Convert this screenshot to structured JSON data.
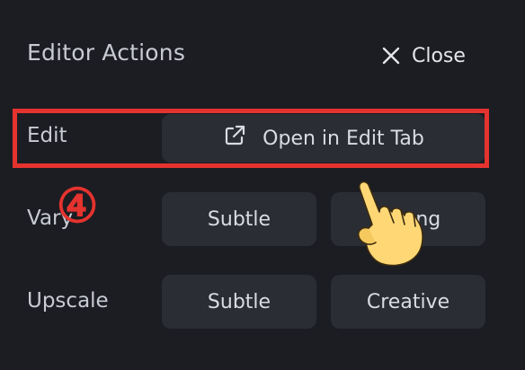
{
  "panel": {
    "title": "Editor Actions",
    "close_label": "Close"
  },
  "rows": {
    "edit": {
      "label": "Edit",
      "button_label": "Open in Edit Tab"
    },
    "vary": {
      "label": "Vary",
      "left_button": "Subtle",
      "right_button": "Strong"
    },
    "upscale": {
      "label": "Upscale",
      "left_button": "Subtle",
      "right_button": "Creative"
    }
  },
  "annotation": {
    "step_marker": "④",
    "highlight_color": "#e5332f"
  },
  "icons": {
    "close": "close-x-icon",
    "external": "external-link-icon",
    "pointer": "pointing-hand-cursor-icon"
  }
}
